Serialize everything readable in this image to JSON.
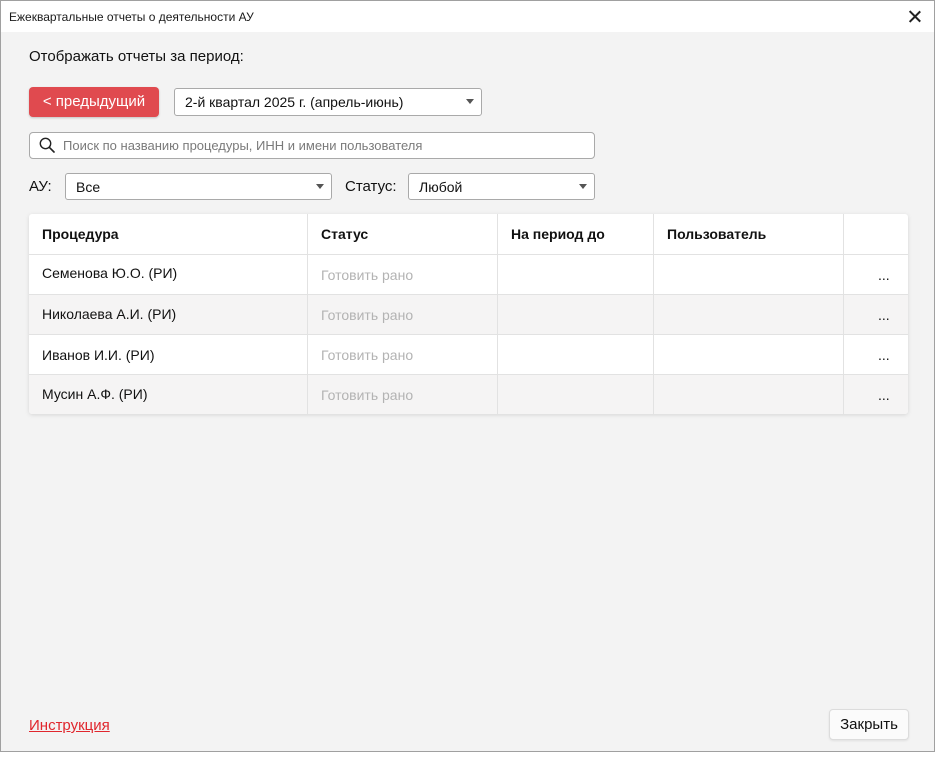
{
  "window": {
    "title": "Ежеквартальные отчеты о деятельности АУ"
  },
  "period": {
    "label": "Отображать отчеты за период:",
    "prev_button": "< предыдущий",
    "selected": "2-й квартал 2025 г. (апрель-июнь)"
  },
  "search": {
    "placeholder": "Поиск по названию процедуры, ИНН и имени пользователя",
    "value": ""
  },
  "filters": {
    "au_label": "АУ:",
    "au_value": "Все",
    "status_label": "Статус:",
    "status_value": "Любой"
  },
  "table": {
    "columns": [
      "Процедура",
      "Статус",
      "На период до",
      "Пользователь",
      ""
    ],
    "rows": [
      {
        "procedure": "Семенова Ю.О. (РИ)",
        "status": "Готовить рано",
        "period_until": "",
        "user": "",
        "menu": "..."
      },
      {
        "procedure": "Николаева А.И. (РИ)",
        "status": "Готовить рано",
        "period_until": "",
        "user": "",
        "menu": "..."
      },
      {
        "procedure": "Иванов И.И. (РИ)",
        "status": "Готовить рано",
        "period_until": "",
        "user": "",
        "menu": "..."
      },
      {
        "procedure": "Мусин А.Ф. (РИ)",
        "status": "Готовить рано",
        "period_until": "",
        "user": "",
        "menu": "..."
      }
    ]
  },
  "footer": {
    "help_link": "Инструкция",
    "close_button": "Закрыть"
  },
  "colors": {
    "accent": "#e04a4f",
    "link": "#e0262d",
    "muted_text": "#b3b3b3",
    "background": "#f3f3f3"
  },
  "icons": {
    "search": "search-icon",
    "close": "close-icon",
    "dropdown": "chevron-down-icon"
  }
}
